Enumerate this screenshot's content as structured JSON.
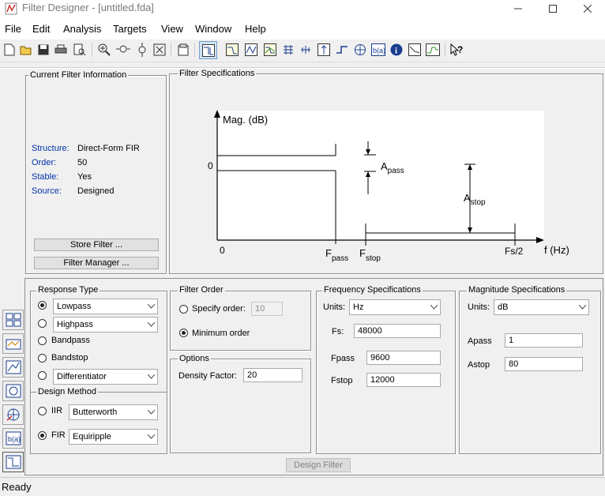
{
  "window": {
    "title": "Filter Designer - [untitled.fda]"
  },
  "menu": [
    "File",
    "Edit",
    "Analysis",
    "Targets",
    "View",
    "Window",
    "Help"
  ],
  "toolbar_icons": [
    "new-icon",
    "open-icon",
    "save-icon",
    "print-icon",
    "print-preview-icon",
    "zoom-in-icon",
    "zoom-x-icon",
    "zoom-y-icon",
    "full-view-icon",
    "new-figure-icon",
    "filter-specs-icon",
    "magnitude-icon",
    "phase-icon",
    "mag-phase-icon",
    "group-delay-icon",
    "phase-delay-icon",
    "impulse-icon",
    "step-icon",
    "pole-zero-icon",
    "coefficients-icon",
    "info-icon",
    "magnitude-estimate-icon",
    "round-off-noise-icon",
    "whats-this-icon"
  ],
  "current_filter": {
    "title": "Current Filter Information",
    "rows": [
      {
        "label": "Structure:",
        "value": "Direct-Form FIR"
      },
      {
        "label": "Order:",
        "value": "50"
      },
      {
        "label": "Stable:",
        "value": "Yes"
      },
      {
        "label": "Source:",
        "value": "Designed"
      }
    ],
    "store_button": "Store Filter ...",
    "manager_button": "Filter Manager ..."
  },
  "filter_specs": {
    "title": "Filter Specifications",
    "mag_label": "Mag. (dB)",
    "zero_y": "0",
    "zero_x": "0",
    "apass_main": "A",
    "apass_sub": "pass",
    "astop_main": "A",
    "astop_sub": "stop",
    "fpass_main": "F",
    "fpass_sub": "pass",
    "fstop_main": "F",
    "fstop_sub": "stop",
    "fs2": "Fs/2",
    "faxis": "f (Hz)"
  },
  "response_type": {
    "title": "Response Type",
    "lowpass": "Lowpass",
    "highpass": "Highpass",
    "bandpass": "Bandpass",
    "bandstop": "Bandstop",
    "differentiator": "Differentiator",
    "selected": "Lowpass"
  },
  "design_method": {
    "title": "Design Method",
    "iir_label": "IIR",
    "iir_value": "Butterworth",
    "fir_label": "FIR",
    "fir_value": "Equiripple",
    "selected": "FIR"
  },
  "filter_order": {
    "title": "Filter Order",
    "specify_label": "Specify order:",
    "specify_value": "10",
    "minimum_label": "Minimum order",
    "selected": "Minimum order"
  },
  "options": {
    "title": "Options",
    "density_label": "Density Factor:",
    "density_value": "20"
  },
  "frequency_specs": {
    "title": "Frequency Specifications",
    "units_label": "Units:",
    "units_value": "Hz",
    "fs_label": "Fs:",
    "fs_value": "48000",
    "fpass_label": "Fpass",
    "fpass_value": "9600",
    "fstop_label": "Fstop",
    "fstop_value": "12000"
  },
  "magnitude_specs": {
    "title": "Magnitude Specifications",
    "units_label": "Units:",
    "units_value": "dB",
    "apass_label": "Apass",
    "apass_value": "1",
    "astop_label": "Astop",
    "astop_value": "80"
  },
  "design_button": "Design Filter",
  "status": "Ready",
  "side_buttons": [
    "transform-filter-icon",
    "create-multirate-icon",
    "realize-model-icon",
    "pole-zero-editor-icon",
    "import-filter-icon",
    "design-filter-icon",
    "target-filter-icon"
  ]
}
